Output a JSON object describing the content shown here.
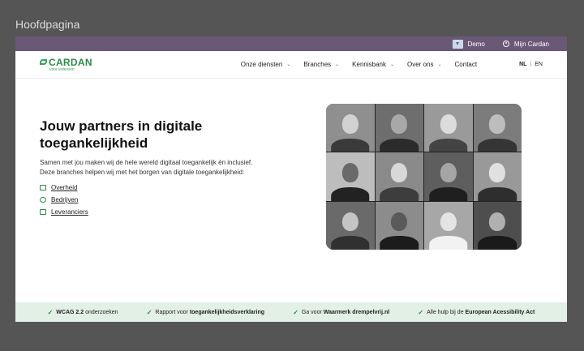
{
  "frame": {
    "title": "Hoofdpagina"
  },
  "topbar": {
    "demo_label": "Demo",
    "account_label": "Mijn Cardan"
  },
  "logo": {
    "name": "CARDAN",
    "tagline": "voor iedereen"
  },
  "nav": {
    "items": [
      "Onze diensten",
      "Branches",
      "Kennisbank",
      "Over ons",
      "Contact"
    ],
    "lang_active": "NL",
    "lang_sep": "|",
    "lang_other": "EN"
  },
  "hero": {
    "title": "Jouw partners in digitale toegankelijkheid",
    "text": "Samen met jou maken wij de hele wereld digitaal toegankelijk én inclusief. Deze branches helpen wij met het borgen van digitale toegankelijkheid:",
    "links": [
      "Overheid",
      "Bedrijven",
      "Leveranciers"
    ]
  },
  "footer": {
    "items": [
      {
        "bold": "WCAG 2.2",
        "text": " onderzoeken",
        "bold_first": true
      },
      {
        "text": "Rapport voor ",
        "bold": "toegankelijkheidsverklaring",
        "bold_first": false
      },
      {
        "text": "Ga voor ",
        "bold": "Waarmerk drempelvrij.nl",
        "bold_first": false
      },
      {
        "text": "Alle hulp bij de ",
        "bold": "European Acessibility Act",
        "bold_first": false
      }
    ]
  },
  "colors": {
    "topbar": "#6b5877",
    "brand_green": "#2a8a4a",
    "footer_bg": "#e3f0e6"
  },
  "icons": {
    "demo": "download-icon",
    "account": "user-icon",
    "check": "check-icon"
  }
}
